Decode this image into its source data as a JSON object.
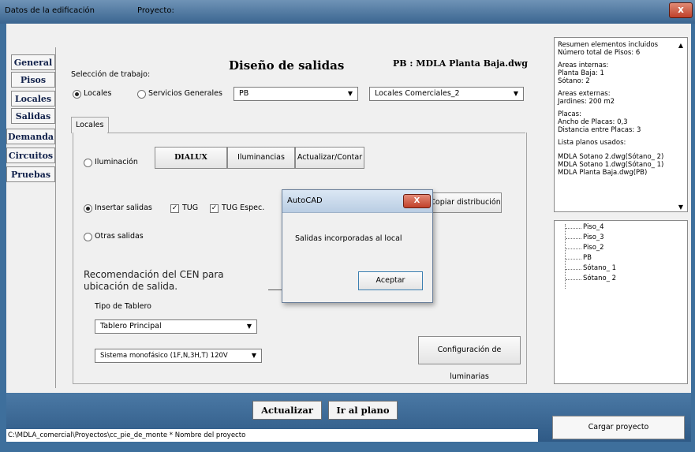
{
  "window": {
    "title": "Datos de la edificación",
    "project_label": "Proyecto:",
    "close_symbol": "x"
  },
  "nav": {
    "tabs": [
      "General",
      "Pisos",
      "Locales",
      "Salidas",
      "Demanda",
      "Circuitos",
      "Pruebas"
    ]
  },
  "main": {
    "title": "Diseño de salidas",
    "file_label": "PB : MDLA Planta Baja.dwg",
    "work_selection_label": "Selección de trabajo:",
    "radio_locales": "Locales",
    "radio_servicios": "Servicios Generales",
    "floor_combo": "PB",
    "locale_combo": "Locales Comerciales_2",
    "subtab_locales": "Locales",
    "radio_iluminacion": "Iluminación",
    "btn_dialux": "DIALUX",
    "btn_iluminancias": "Iluminancias",
    "btn_actualizar_contar": "Actualizar/Contar",
    "radio_insertar": "Insertar salidas",
    "chk_tug": "TUG",
    "chk_tug_espec": "TUG Espec.",
    "btn_copiar": "Copiar distribución",
    "radio_otras": "Otras salidas",
    "recommendation": "Recomendación del CEN para ubicación de salida.",
    "board_type_label": "Tipo de Tablero",
    "board_combo": "Tablero Principal",
    "system_combo": "Sistema monofásico (1F,N,3H,T) 120V",
    "btn_config_luminarias": "Configuración de luminarias"
  },
  "dialog": {
    "title": "AutoCAD",
    "message": "Salidas incorporadas al local",
    "ok_label": "Aceptar",
    "close_symbol": "X"
  },
  "summary": {
    "lines": [
      "Resumen elementos incluidos",
      "Número total de Pisos: 6",
      "",
      "Areas internas:",
      "Planta Baja: 1",
      "Sótano: 2",
      "",
      "Areas externas:",
      "Jardines: 200 m2",
      "",
      "Placas:",
      "Ancho de Placas: 0,3",
      "Distancia entre Placas: 3",
      "",
      "Lista planos usados:",
      "",
      "MDLA Sotano 2.dwg(Sótano_ 2)",
      "MDLA Sotano 1.dwg(Sótano_ 1)",
      "MDLA Planta Baja.dwg(PB)"
    ]
  },
  "tree": {
    "items": [
      "Piso_4",
      "Piso_3",
      "Piso_2",
      "PB",
      "Sótano_ 1",
      "Sótano_ 2"
    ]
  },
  "bottom": {
    "btn_actualizar": "Actualizar",
    "btn_ir_plano": "Ir al plano",
    "status_path": "C:\\MDLA_comercial\\Proyectos\\cc_pie_de_monte * Nombre del proyecto",
    "btn_cargar": "Cargar proyecto"
  }
}
